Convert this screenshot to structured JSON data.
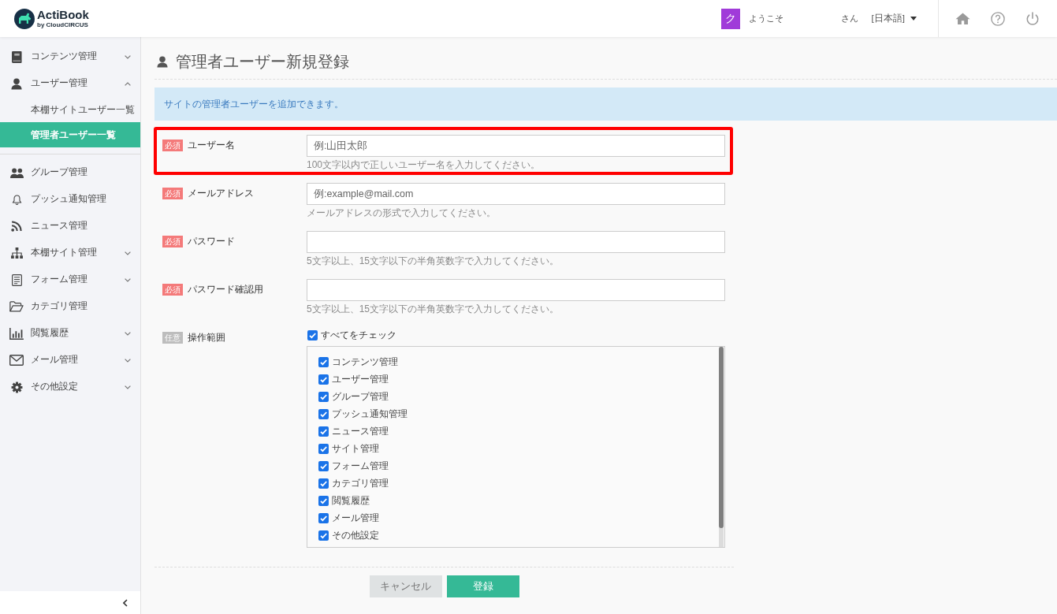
{
  "header": {
    "logo": {
      "name": "ActiBook",
      "byline": "by CloudCIRCUS"
    },
    "user": {
      "avatar_initial": "ク",
      "greeting": "ようこそ",
      "honorific": "さん",
      "language": "[日本語]"
    }
  },
  "sidebar": {
    "items": [
      {
        "label": "コンテンツ管理",
        "kind": "menu",
        "expanded": false,
        "selected": false
      },
      {
        "label": "ユーザー管理",
        "kind": "menu",
        "expanded": true,
        "selected": false,
        "children": [
          {
            "label": "本棚サイトユーザー一覧",
            "selected": false
          },
          {
            "label": "管理者ユーザー一覧",
            "selected": true
          }
        ]
      },
      {
        "label": "グループ管理",
        "kind": "link",
        "selected": false
      },
      {
        "label": "プッシュ通知管理",
        "kind": "link",
        "selected": false
      },
      {
        "label": "ニュース管理",
        "kind": "link",
        "selected": false
      },
      {
        "label": "本棚サイト管理",
        "kind": "menu",
        "expanded": false,
        "selected": false
      },
      {
        "label": "フォーム管理",
        "kind": "menu",
        "expanded": false,
        "selected": false
      },
      {
        "label": "カテゴリ管理",
        "kind": "link",
        "selected": false
      },
      {
        "label": "閲覧履歴",
        "kind": "menu",
        "expanded": false,
        "selected": false
      },
      {
        "label": "メール管理",
        "kind": "menu",
        "expanded": false,
        "selected": false
      },
      {
        "label": "その他設定",
        "kind": "menu",
        "expanded": false,
        "selected": false
      }
    ]
  },
  "page": {
    "title": "管理者ユーザー新規登録",
    "info": "サイトの管理者ユーザーを追加できます。",
    "fields": [
      {
        "kind": "text",
        "badge": "必須",
        "required": true,
        "label": "ユーザー名",
        "placeholder": "例:山田太郎",
        "hint": "100文字以内で正しいユーザー名を入力してください。",
        "highlighted": true
      },
      {
        "kind": "text",
        "badge": "必須",
        "required": true,
        "label": "メールアドレス",
        "placeholder": "例:example@mail.com",
        "hint": "メールアドレスの形式で入力してください。",
        "highlighted": false
      },
      {
        "kind": "password",
        "badge": "必須",
        "required": true,
        "label": "パスワード",
        "hint": "5文字以上、15文字以下の半角英数字で入力してください。",
        "highlighted": false
      },
      {
        "kind": "password",
        "badge": "必須",
        "required": true,
        "label": "パスワード確認用",
        "hint": "5文字以上、15文字以下の半角英数字で入力してください。",
        "highlighted": false
      },
      {
        "kind": "checklist",
        "badge": "任意",
        "required": false,
        "label": "操作範囲",
        "highlighted": false,
        "check_all": {
          "label": "すべてをチェック",
          "checked": true
        },
        "options": [
          {
            "label": "コンテンツ管理",
            "checked": true
          },
          {
            "label": "ユーザー管理",
            "checked": true
          },
          {
            "label": "グループ管理",
            "checked": true
          },
          {
            "label": "プッシュ通知管理",
            "checked": true
          },
          {
            "label": "ニュース管理",
            "checked": true
          },
          {
            "label": "サイト管理",
            "checked": true
          },
          {
            "label": "フォーム管理",
            "checked": true
          },
          {
            "label": "カテゴリ管理",
            "checked": true
          },
          {
            "label": "閲覧履歴",
            "checked": true
          },
          {
            "label": "メール管理",
            "checked": true
          },
          {
            "label": "その他設定",
            "checked": true
          }
        ]
      }
    ],
    "buttons": [
      {
        "label": "キャンセル",
        "kind": "secondary"
      },
      {
        "label": "登録",
        "kind": "primary"
      }
    ]
  }
}
